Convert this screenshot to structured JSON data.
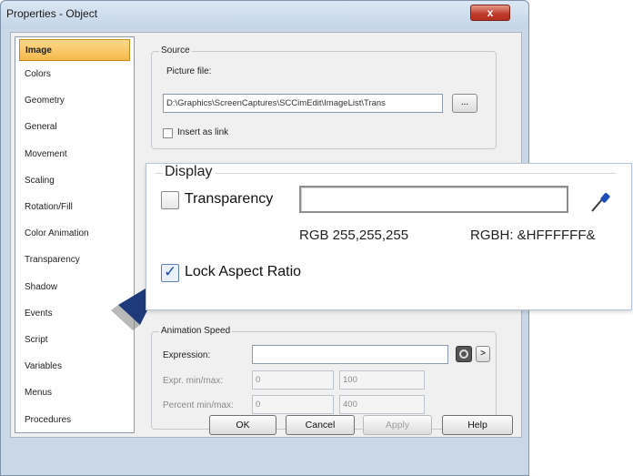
{
  "window": {
    "title": "Properties - Object",
    "close_glyph": "x"
  },
  "nav": {
    "items": [
      {
        "label": "Image",
        "selected": true
      },
      {
        "label": "Colors"
      },
      {
        "label": "Geometry"
      },
      {
        "label": "General"
      },
      {
        "label": "Movement"
      },
      {
        "label": "Scaling"
      },
      {
        "label": "Rotation/Fill"
      },
      {
        "label": "Color Animation"
      },
      {
        "label": "Transparency"
      },
      {
        "label": "Shadow"
      },
      {
        "label": "Events"
      },
      {
        "label": "Script"
      },
      {
        "label": "Variables"
      },
      {
        "label": "Menus"
      },
      {
        "label": "Procedures"
      }
    ]
  },
  "source": {
    "legend": "Source",
    "picture_file_label": "Picture file:",
    "picture_file_value": "D:\\Graphics\\ScreenCaptures\\SCCimEdit\\ImageList\\Trans",
    "browse_label": "...",
    "insert_as_link_label": "Insert as link",
    "insert_as_link_checked": false
  },
  "display": {
    "legend": "Display",
    "transparency_label": "Transparency",
    "transparency_checked": false,
    "rgb_text": "RGB  255,255,255",
    "rgbh_text": "RGBH: &HFFFFFF&",
    "lock_aspect_label": "Lock Aspect Ratio",
    "lock_aspect_checked": true,
    "check_glyph": "✓",
    "eyedropper_icon": "eyedropper-icon"
  },
  "animation": {
    "legend": "Animation Speed",
    "expression_label": "Expression:",
    "expression_value": "",
    "expr_minmax_label": "Expr. min/max:",
    "expr_min": "0",
    "expr_max": "100",
    "percent_minmax_label": "Percent min/max:",
    "percent_min": "0",
    "percent_max": "400",
    "arrow_glyph": ">"
  },
  "footer": {
    "ok_label": "OK",
    "cancel_label": "Cancel",
    "apply_label": "Apply",
    "help_label": "Help"
  },
  "colors": {
    "selected_nav": "#f6b94a",
    "close_button": "#c0392b",
    "callout_arrow": "#1f3a7a"
  }
}
